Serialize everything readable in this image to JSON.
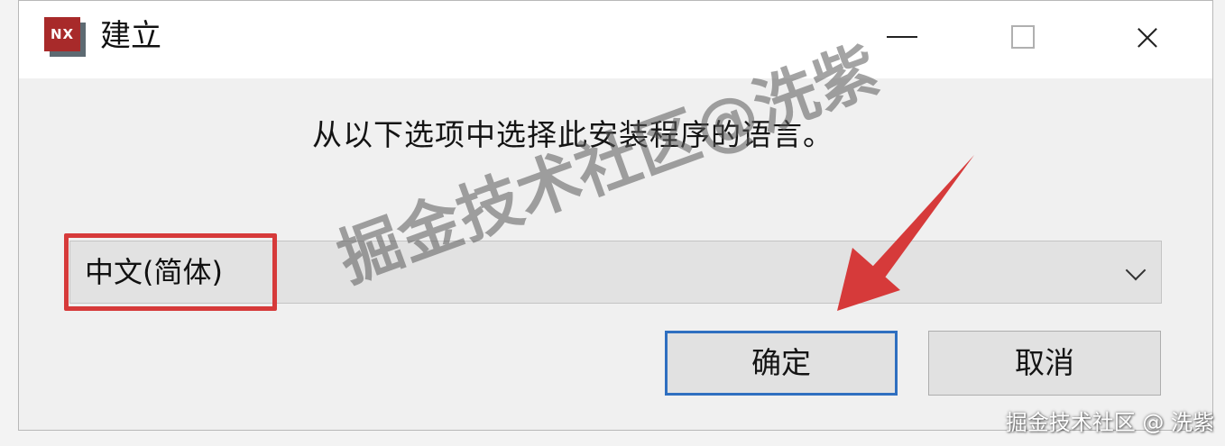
{
  "window": {
    "app_icon_text": "NX",
    "title": "建立",
    "close_glyph": "×"
  },
  "dialog": {
    "prompt": "从以下选项中选择此安装程序的语言。",
    "language_select": {
      "selected": "中文(简体)"
    },
    "buttons": {
      "ok": "确定",
      "cancel": "取消"
    }
  },
  "annotations": {
    "highlight_color": "#d63a3a",
    "arrow_color": "#d63a3a",
    "watermark_text": "掘金技术社区@洗紫",
    "footer_watermark": "掘金技术社区 @ 洗紫"
  },
  "colors": {
    "dialog_bg": "#f0f0f0",
    "titlebar_bg": "#ffffff",
    "ok_border": "#2f6fc0",
    "icon_red": "#a82a2a"
  }
}
